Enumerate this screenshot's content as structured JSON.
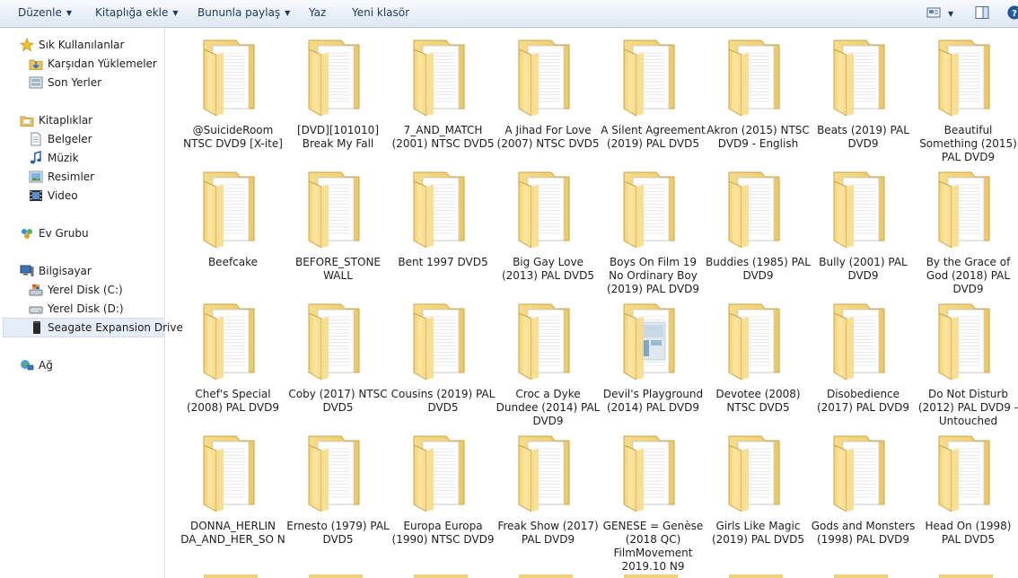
{
  "toolbar": {
    "organize": "Düzenle",
    "include_in_library": "Kitaplığa ekle",
    "share_with": "Bununla paylaş",
    "burn": "Yaz",
    "new_folder": "Yeni klasör"
  },
  "nav": {
    "favorites": "Sık Kullanılanlar",
    "downloads": "Karşıdan Yüklemeler",
    "recent": "Son Yerler",
    "libraries": "Kitaplıklar",
    "documents": "Belgeler",
    "music": "Müzik",
    "pictures": "Resimler",
    "videos": "Video",
    "homegroup": "Ev Grubu",
    "computer": "Bilgisayar",
    "disk_c": "Yerel Disk (C:)",
    "disk_d": "Yerel Disk (D:)",
    "seagate": "Seagate Expansion Drive",
    "network": "Ağ"
  },
  "folders": [
    {
      "name": "@SuicideRoom NTSC DVD9 [X-ite]"
    },
    {
      "name": "[DVD][101010] Break My Fall"
    },
    {
      "name": "7_AND_MATCH (2001) NTSC DVD5"
    },
    {
      "name": "A Jihad For Love (2007) NTSC DVD5"
    },
    {
      "name": "A Silent Agreement (2019) PAL DVD5"
    },
    {
      "name": "Akron (2015) NTSC DVD9 - English"
    },
    {
      "name": "Beats (2019) PAL DVD9"
    },
    {
      "name": "Beautiful Something (2015) PAL DVD9"
    },
    {
      "name": "Beefcake"
    },
    {
      "name": "BEFORE_STONE WALL"
    },
    {
      "name": "Bent 1997 DVD5"
    },
    {
      "name": "Big Gay Love (2013) PAL DVD5"
    },
    {
      "name": "Boys On Film 19 No Ordinary Boy (2019) PAL DVD9"
    },
    {
      "name": "Buddies (1985) PAL DVD9"
    },
    {
      "name": "Bully (2001) PAL DVD9"
    },
    {
      "name": "By the Grace of God (2018) PAL DVD9"
    },
    {
      "name": "Chef's Special (2008) PAL DVD9"
    },
    {
      "name": "Coby (2017) NTSC DVD5"
    },
    {
      "name": "Cousins (2019) PAL DVD5"
    },
    {
      "name": "Croc a Dyke Dundee (2014) PAL DVD9"
    },
    {
      "name": "Devil's Playground (2014) PAL DVD9",
      "has_preview": true
    },
    {
      "name": "Devotee (2008) NTSC DVD5"
    },
    {
      "name": "Disobedience (2017) PAL DVD9"
    },
    {
      "name": "Do Not Disturb (2012) PAL DVD9 - Untouched"
    },
    {
      "name": "DONNA_HERLIN DA_AND_HER_SO N"
    },
    {
      "name": "Ernesto (1979) PAL DVD5"
    },
    {
      "name": "Europa Europa (1990) NTSC DVD9"
    },
    {
      "name": "Freak Show (2017) PAL DVD9"
    },
    {
      "name": "GENESE = Genèse (2018 QC) FilmMovement 2019.10 N9"
    },
    {
      "name": "Girls Like Magic (2019) PAL DVD5"
    },
    {
      "name": "Gods and Monsters (1998) PAL DVD9"
    },
    {
      "name": "Head On (1998) PAL DVD5"
    }
  ]
}
